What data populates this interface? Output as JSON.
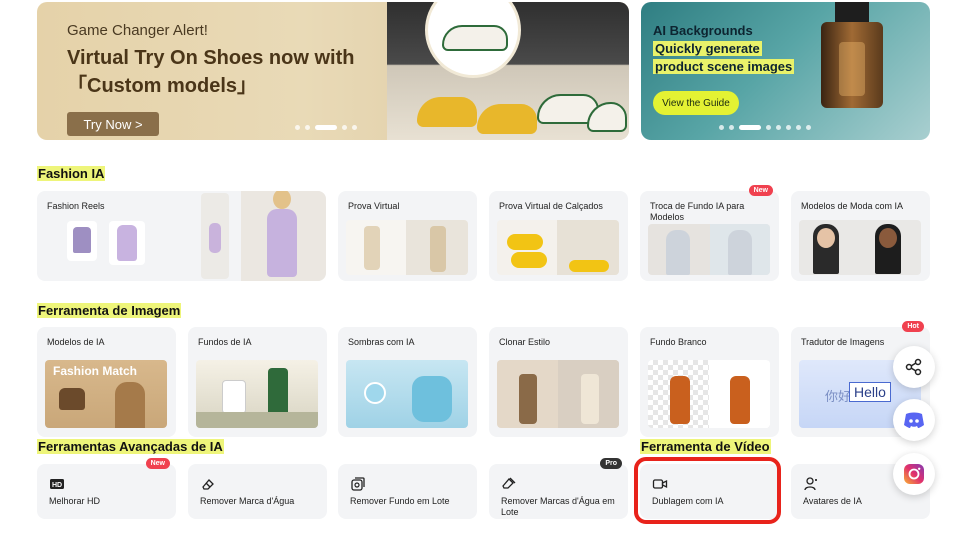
{
  "banner_main": {
    "eyebrow": "Game Changer Alert!",
    "title": "Virtual Try On Shoes now with「Custom models」",
    "button": "Try Now >"
  },
  "banner_side": {
    "title_line1": "AI Backgrounds",
    "title_line2": "Quickly generate",
    "title_line3": "product scene images",
    "button": "View the Guide"
  },
  "sections": {
    "fashion": "Fashion IA",
    "image": "Ferramenta de Imagem",
    "advanced": "Ferramentas Avançadas de IA",
    "video": "Ferramenta de Vídeo"
  },
  "fashion_cards": [
    {
      "label": "Fashion Reels"
    },
    {
      "label": "Prova Virtual"
    },
    {
      "label": "Prova Virtual de Calçados"
    },
    {
      "label": "Troca de Fundo IA para Modelos",
      "badge": "New"
    },
    {
      "label": "Modelos de Moda com IA"
    }
  ],
  "image_cards": [
    {
      "label": "Modelos de IA",
      "thumb_text": "Fashion Match"
    },
    {
      "label": "Fundos de IA"
    },
    {
      "label": "Sombras com IA"
    },
    {
      "label": "Clonar Estilo"
    },
    {
      "label": "Fundo Branco"
    },
    {
      "label": "Tradutor de Imagens",
      "badge": "Hot",
      "thumb_text_cn": "你好",
      "thumb_text": "Hello"
    }
  ],
  "advanced_tools": [
    {
      "label": "Melhorar HD",
      "badge": "New",
      "icon": "hd-icon"
    },
    {
      "label": "Remover Marca d'Água",
      "icon": "eraser-icon"
    },
    {
      "label": "Remover Fundo em Lote",
      "icon": "batch-cutout-icon"
    },
    {
      "label": "Remover Marcas d'Água em Lote",
      "badge": "Pro",
      "icon": "batch-eraser-icon"
    }
  ],
  "video_tools": [
    {
      "label": "Dublagem com IA",
      "icon": "video-camera-icon"
    },
    {
      "label": "Avatares de IA",
      "icon": "avatar-icon"
    }
  ],
  "colors": {
    "accent_highlight": "#e9f26a",
    "badge_red": "#f0414f",
    "selection_ring": "#e8231b",
    "discord": "#5865f2"
  }
}
